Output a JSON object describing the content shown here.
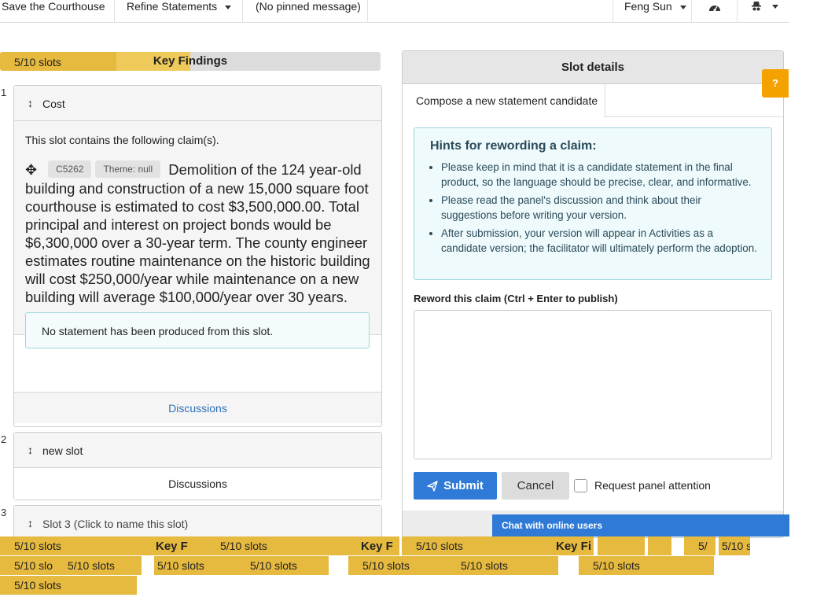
{
  "nav": {
    "home": "Save the Courthouse",
    "refine": "Refine Statements",
    "pinned": "(No pinned message)",
    "user": "Feng Sun"
  },
  "slots_bar": {
    "label": "5/10 slots",
    "title": "Key Findings",
    "filled": 5,
    "total": 10
  },
  "slots": [
    {
      "number": "1",
      "name": "Cost",
      "contains_text": "This slot contains the following claim(s).",
      "claim_id": "C5262",
      "theme": "Theme: null",
      "claim_text": "Demolition of the 124 year-old building and construction of a new 15,000 square foot courthouse is estimated to cost $3,500,000.00. Total principal and interest on project bonds would be $6,300,000 over a 30-year term. The county engineer estimates routine maintenance on the historic building will cost $250,000/year while maintenance on a new building will average $100,000/year over 30 years.",
      "notice": "No statement has been produced from this slot.",
      "discussions": "Discussions"
    },
    {
      "number": "2",
      "name": "new slot",
      "discussions": "Discussions"
    },
    {
      "number": "3",
      "name": "Slot 3 (Click to name this slot)"
    }
  ],
  "panel": {
    "title": "Slot details",
    "tab": "Compose a new statement candidate",
    "hints_title": "Hints for rewording a claim:",
    "hints": [
      "Please keep in mind that it is a candidate statement in the final product, so the language should be precise, clear, and informative.",
      "Please read the panel's discussion and think about their suggestions before writing your version.",
      "After submission, your version will appear in Activities as a candidate version; the facilitator will ultimately perform the adoption."
    ],
    "reword_label": "Reword this claim (Ctrl + Enter to publish)",
    "submit": "Submit",
    "cancel": "Cancel",
    "attention": "Request panel attention"
  },
  "help": "?",
  "chat": "Chat with online users",
  "ghost_bars": {
    "slots": "5/10 slots",
    "slots_trunc": "5/10 slo",
    "title1": "Key F",
    "title2": "Key F",
    "title3": "Key Fi",
    "frag1": "5/",
    "frag2": "5/10 s"
  },
  "colors": {
    "accent": "#2e7ad6",
    "slot_bar": "#e6b93f",
    "help": "#f3a200",
    "hint_border": "#9fd6d8"
  }
}
